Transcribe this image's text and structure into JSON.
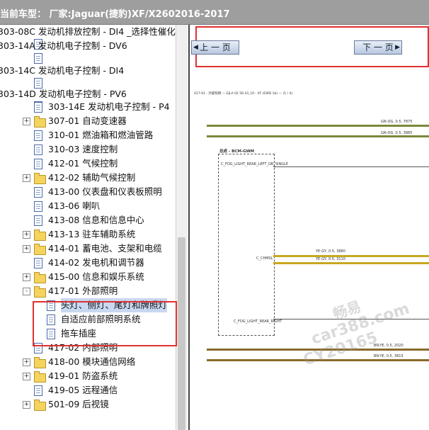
{
  "title": "当前车型：  厂家:Jaguar(捷豹)XF/X2602016-2017",
  "tree_items": [
    {
      "label": "303-08C 发动机排放控制 - DI4 _选择性催化",
      "icon": "folder-icon",
      "expander": "none"
    },
    {
      "label": "303-14A 发动机电子控制 - DV6",
      "icon": "folder-icon",
      "expander": "none"
    },
    {
      "label": "303-14C 发动机电子控制 - DI4",
      "icon": "folder-icon",
      "expander": "none"
    },
    {
      "label": "303-14D 发动机电子控制 - PV6",
      "icon": "folder-icon",
      "expander": "none"
    },
    {
      "label": "303-14E 发动机电子控制 - P4",
      "icon": "page-icon",
      "expander": "none"
    },
    {
      "label": "307-01 自动变速器",
      "icon": "folder-icon",
      "expander": "+"
    },
    {
      "label": "310-01 燃油箱和燃油管路",
      "icon": "page-icon",
      "expander": "none"
    },
    {
      "label": "310-03 速度控制",
      "icon": "page-icon",
      "expander": "none"
    },
    {
      "label": "412-01 气候控制",
      "icon": "page-icon",
      "expander": "none"
    },
    {
      "label": "412-02 辅助气候控制",
      "icon": "folder-icon",
      "expander": "+"
    },
    {
      "label": "413-00 仪表盘和仪表板照明",
      "icon": "page-icon",
      "expander": "none"
    },
    {
      "label": "413-06 喇叭",
      "icon": "page-icon",
      "expander": "none"
    },
    {
      "label": "413-08 信息和信息中心",
      "icon": "page-icon",
      "expander": "none"
    },
    {
      "label": "413-13 驻车辅助系统",
      "icon": "folder-icon",
      "expander": "+"
    },
    {
      "label": "414-01 蓄电池、支架和电缆",
      "icon": "folder-icon",
      "expander": "+"
    },
    {
      "label": "414-02 发电机和调节器",
      "icon": "page-icon",
      "expander": "none"
    },
    {
      "label": "415-00 信息和娱乐系统",
      "icon": "folder-icon",
      "expander": "+"
    },
    {
      "label": "417-01 外部照明",
      "icon": "folder-icon",
      "expander": "-"
    },
    {
      "label": "头灯、侧灯、尾灯和牌照灯",
      "icon": "page-icon",
      "expander": "none",
      "selected": true
    },
    {
      "label": "自适应前部照明系统",
      "icon": "page-icon",
      "expander": "none"
    },
    {
      "label": "拖车插座",
      "icon": "page-icon",
      "expander": "none"
    },
    {
      "label": "417-02 内部照明",
      "icon": "page-icon",
      "expander": "none"
    },
    {
      "label": "418-00 模块通信网络",
      "icon": "folder-icon",
      "expander": "+"
    },
    {
      "label": "419-01 防盗系统",
      "icon": "folder-icon",
      "expander": "+"
    },
    {
      "label": "419-05 远程通信",
      "icon": "page-icon",
      "expander": "none"
    },
    {
      "label": "501-09 后视镜",
      "icon": "folder-icon",
      "expander": "+"
    }
  ],
  "viewer": {
    "prev_label": "上 一 页",
    "next_label": "下 一 页",
    "page_header": "417-01 - 外部照明 — EJLA 02 58 43_10 - XF (EWD 1b) — (1 / 4)",
    "module_label": "总成 - BCM-GWM",
    "pins": [
      "C_FOG_LIGHT_REAR_LEFT_OR_SINGLE",
      "C_CHMSL",
      "C_FOG_LIGHT_REAR_RIGHT"
    ],
    "wires": [
      {
        "label": "GN-OG, 0.5, 7875",
        "color": "#7a8a3a"
      },
      {
        "label": "GN-OG, 0.5, 3885",
        "color": "#7a8a3a"
      },
      {
        "label": "YE-GY, 0.5, 3880",
        "color": "#c8a820"
      },
      {
        "label": "YE-GY, 0.5, 3110",
        "color": "#c8a820"
      },
      {
        "label": "BN-YE, 0.5, 2020",
        "color": "#8a6a2a"
      },
      {
        "label": "BN-YE, 0.5, 3815",
        "color": "#8a6a2a"
      }
    ],
    "watermark": [
      "畅易",
      "car388.com",
      "CY20165"
    ]
  },
  "colors": {
    "title_bar": "#9e9e9e",
    "highlight": "#e03030",
    "selection": "#c8d8f0"
  }
}
